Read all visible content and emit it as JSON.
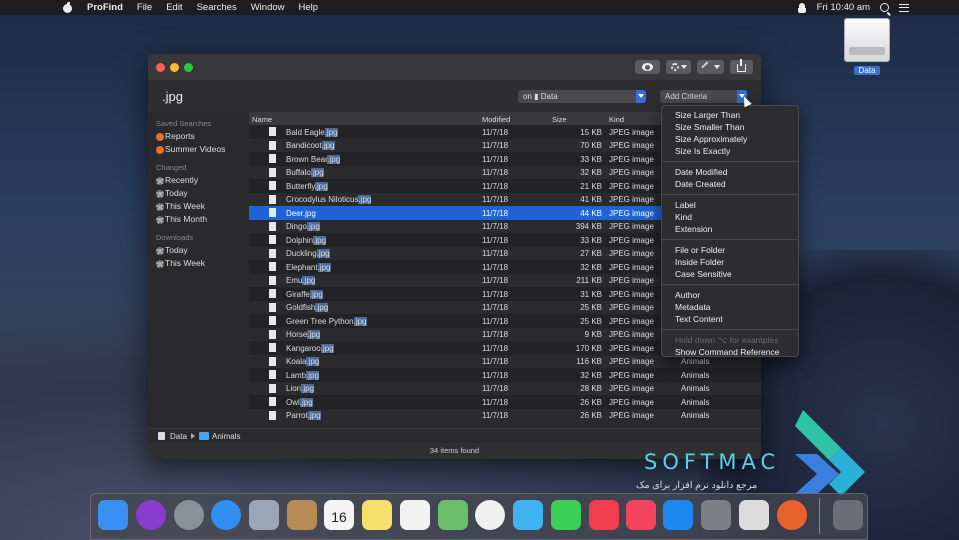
{
  "menubar": {
    "app_name": "ProFind",
    "items": [
      "File",
      "Edit",
      "Searches",
      "Window",
      "Help"
    ],
    "clock": "Fri 10:40 am"
  },
  "desktop": {
    "drive_label": "Data"
  },
  "window": {
    "query": ".jpg",
    "scope": "on ▮ Data",
    "add_criteria": "Add Criteria",
    "sidebar": {
      "saved_header": "Saved Searches",
      "saved": [
        "Reports",
        "Summer Videos"
      ],
      "changed_header": "Changed",
      "changed": [
        "Recently",
        "Today",
        "This Week",
        "This Month"
      ],
      "downloads_header": "Downloads",
      "downloads": [
        "Today",
        "This Week"
      ]
    },
    "columns": {
      "name": "Name",
      "modified": "Modified",
      "size": "Size",
      "kind": "Kind"
    },
    "rows": [
      {
        "base": "Bald Eagle",
        "ext": ".jpg",
        "modified": "11/7/18",
        "size": "15 KB",
        "kind": "JPEG image",
        "where": ""
      },
      {
        "base": "Bandicoot",
        "ext": ".jpg",
        "modified": "11/7/18",
        "size": "70 KB",
        "kind": "JPEG image",
        "where": ""
      },
      {
        "base": "Brown Bear",
        "ext": ".jpg",
        "modified": "11/7/18",
        "size": "33 KB",
        "kind": "JPEG image",
        "where": ""
      },
      {
        "base": "Buffalo",
        "ext": ".jpg",
        "modified": "11/7/18",
        "size": "32 KB",
        "kind": "JPEG image",
        "where": ""
      },
      {
        "base": "Butterfly",
        "ext": ".jpg",
        "modified": "11/7/18",
        "size": "21 KB",
        "kind": "JPEG image",
        "where": ""
      },
      {
        "base": "Crocodylus Niloticus",
        "ext": ".jpg",
        "modified": "11/7/18",
        "size": "41 KB",
        "kind": "JPEG image",
        "where": ""
      },
      {
        "base": "Deer",
        "ext": ".jpg",
        "modified": "11/7/18",
        "size": "44 KB",
        "kind": "JPEG image",
        "where": ""
      },
      {
        "base": "Dingo",
        "ext": ".jpg",
        "modified": "11/7/18",
        "size": "394 KB",
        "kind": "JPEG image",
        "where": ""
      },
      {
        "base": "Dolphin",
        "ext": ".jpg",
        "modified": "11/7/18",
        "size": "33 KB",
        "kind": "JPEG image",
        "where": ""
      },
      {
        "base": "Duckling",
        "ext": ".jpg",
        "modified": "11/7/18",
        "size": "27 KB",
        "kind": "JPEG image",
        "where": ""
      },
      {
        "base": "Elephant",
        "ext": ".jpg",
        "modified": "11/7/18",
        "size": "32 KB",
        "kind": "JPEG image",
        "where": ""
      },
      {
        "base": "Emu",
        "ext": ".jpg",
        "modified": "11/7/18",
        "size": "211 KB",
        "kind": "JPEG image",
        "where": ""
      },
      {
        "base": "Giraffe",
        "ext": ".jpg",
        "modified": "11/7/18",
        "size": "31 KB",
        "kind": "JPEG image",
        "where": ""
      },
      {
        "base": "Goldfish",
        "ext": ".jpg",
        "modified": "11/7/18",
        "size": "25 KB",
        "kind": "JPEG image",
        "where": ""
      },
      {
        "base": "Green Tree Python",
        "ext": ".jpg",
        "modified": "11/7/18",
        "size": "25 KB",
        "kind": "JPEG image",
        "where": ""
      },
      {
        "base": "Horse",
        "ext": ".jpg",
        "modified": "11/7/18",
        "size": "9 KB",
        "kind": "JPEG image",
        "where": ""
      },
      {
        "base": "Kangaroo",
        "ext": ".jpg",
        "modified": "11/7/18",
        "size": "170 KB",
        "kind": "JPEG image",
        "where": ""
      },
      {
        "base": "Koala",
        "ext": ".jpg",
        "modified": "11/7/18",
        "size": "116 KB",
        "kind": "JPEG image",
        "where": "Animals"
      },
      {
        "base": "Lamb",
        "ext": ".jpg",
        "modified": "11/7/18",
        "size": "32 KB",
        "kind": "JPEG image",
        "where": "Animals"
      },
      {
        "base": "Lion",
        "ext": ".jpg",
        "modified": "11/7/18",
        "size": "28 KB",
        "kind": "JPEG image",
        "where": "Animals"
      },
      {
        "base": "Owl",
        "ext": ".jpg",
        "modified": "11/7/18",
        "size": "26 KB",
        "kind": "JPEG image",
        "where": "Animals"
      },
      {
        "base": "Parrot",
        "ext": ".jpg",
        "modified": "11/7/18",
        "size": "26 KB",
        "kind": "JPEG image",
        "where": "Animals"
      }
    ],
    "path": {
      "drive": "Data",
      "folder": "Animals"
    },
    "status": "34 items found"
  },
  "criteria_menu": {
    "groups": [
      [
        "Size Larger Than",
        "Size Smaller Than",
        "Size Approximately",
        "Size Is Exactly"
      ],
      [
        "Date Modified",
        "Date Created"
      ],
      [
        "Label",
        "Kind",
        "Extension"
      ],
      [
        "File or Folder",
        "Inside Folder",
        "Case Sensitive"
      ],
      [
        "Author",
        "Metadata",
        "Text Content"
      ]
    ],
    "hint": "Hold down ⌥ for examples",
    "reference": "Show Command Reference"
  },
  "watermark": {
    "title": "SOFTMAC",
    "subtitle": "مرجع دانلود نرم افزار برای مک"
  },
  "dock": {
    "icons": [
      {
        "name": "finder-icon",
        "color": "#3c8ff2"
      },
      {
        "name": "siri-icon",
        "color": "#8a3ccf"
      },
      {
        "name": "launchpad-icon",
        "color": "#8b8f99"
      },
      {
        "name": "safari-icon",
        "color": "#2f8ef0"
      },
      {
        "name": "mail-stamp-icon",
        "color": "#9aa6b8"
      },
      {
        "name": "contacts-icon",
        "color": "#b88a55"
      },
      {
        "name": "calendar-icon",
        "color": "#f4f4f4"
      },
      {
        "name": "notes-icon",
        "color": "#f6df6a"
      },
      {
        "name": "reminders-icon",
        "color": "#f2f2f2"
      },
      {
        "name": "maps-icon",
        "color": "#6cbf6a"
      },
      {
        "name": "photos-icon",
        "color": "#f0f0f0"
      },
      {
        "name": "messages-icon",
        "color": "#3fb3f2"
      },
      {
        "name": "facetime-icon",
        "color": "#3ccf55"
      },
      {
        "name": "news-icon",
        "color": "#f23e4c"
      },
      {
        "name": "music-icon",
        "color": "#f4435c"
      },
      {
        "name": "app-store-icon",
        "color": "#1e88f2"
      },
      {
        "name": "system-preferences-icon",
        "color": "#7d7f86"
      },
      {
        "name": "screenshot-icon",
        "color": "#dcdcdc"
      },
      {
        "name": "profind-icon",
        "color": "#e9622b"
      },
      {
        "name": "trash-icon",
        "color": "#6a6d75"
      }
    ],
    "calendar_day": "16"
  }
}
